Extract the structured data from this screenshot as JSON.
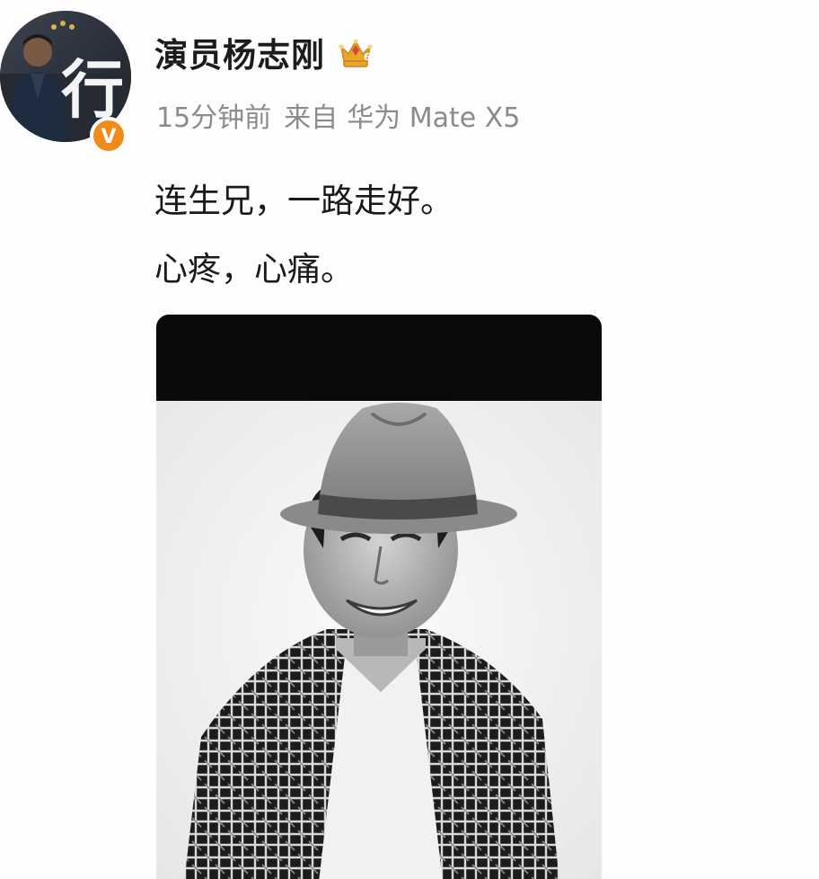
{
  "post": {
    "author": {
      "name": "演员杨志刚",
      "avatar_icon": "avatar-calligraphy-icon",
      "avatar_glyph": "行",
      "verified_icon": "verified-v-icon",
      "verified_glyph": "V",
      "crown_icon": "crown-level-icon",
      "crown_level": "6"
    },
    "meta": {
      "time": "15分钟前",
      "via": "来自",
      "device": "华为 Mate X5"
    },
    "text_lines": [
      "连生兄，一路走好。",
      "心疼，心痛。"
    ],
    "image": {
      "subject": "black-and-white portrait of a smiling man in a fedora hat and patterned jacket"
    }
  },
  "colors": {
    "name": "#1c1c1c",
    "meta": "#8b8b8b",
    "verified": "#f08a19",
    "crown": "#e8a62b"
  }
}
